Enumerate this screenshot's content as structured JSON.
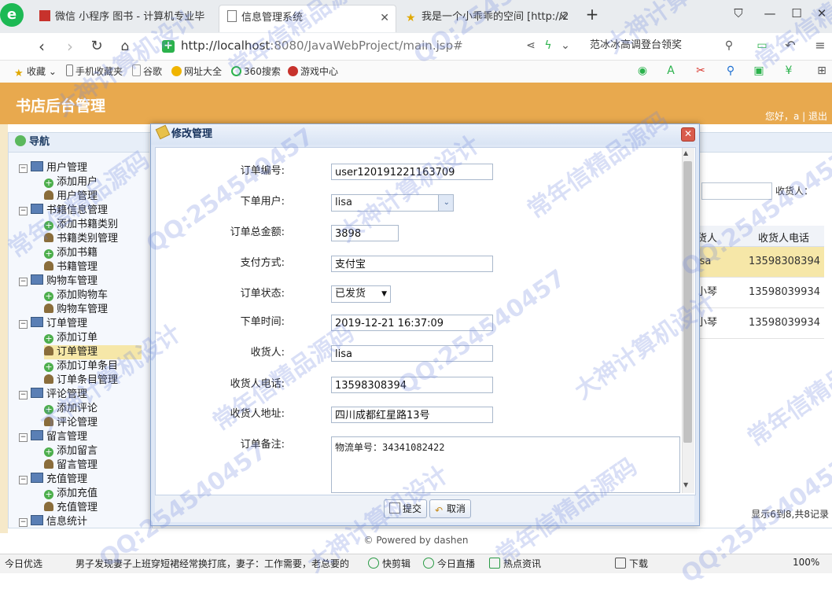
{
  "browser": {
    "tabs": [
      {
        "label": "微信 小程序 图书 - 计算机专业毕",
        "active": false,
        "icon": "red-square-icon"
      },
      {
        "label": "信息管理系统",
        "active": true,
        "icon": "page-icon"
      },
      {
        "label": "我是一个小乖乖的空间 [http://2",
        "active": false,
        "icon": "star-icon"
      }
    ],
    "url": {
      "host": "http://localhost",
      "path": ":8080/JavaWebProject/main.jsp#"
    },
    "search_hint": "范冰冰高调登台领奖",
    "favorites": [
      "收藏",
      "手机收藏夹",
      "谷歌",
      "网址大全",
      "360搜索",
      "游戏中心"
    ]
  },
  "app": {
    "title": "书店后台管理",
    "user_bar": "您好，a | 退出",
    "nav_title": "导航",
    "footer": "© Powered by dashen"
  },
  "nav": [
    {
      "label": "用户管理",
      "type": "group"
    },
    {
      "label": "添加用户",
      "type": "add"
    },
    {
      "label": "用户管理",
      "type": "manage"
    },
    {
      "label": "书籍信息管理",
      "type": "group"
    },
    {
      "label": "添加书籍类别",
      "type": "add"
    },
    {
      "label": "书籍类别管理",
      "type": "manage"
    },
    {
      "label": "添加书籍",
      "type": "add"
    },
    {
      "label": "书籍管理",
      "type": "manage"
    },
    {
      "label": "购物车管理",
      "type": "group"
    },
    {
      "label": "添加购物车",
      "type": "add"
    },
    {
      "label": "购物车管理",
      "type": "manage"
    },
    {
      "label": "订单管理",
      "type": "group"
    },
    {
      "label": "添加订单",
      "type": "add"
    },
    {
      "label": "订单管理",
      "type": "manage",
      "selected": true
    },
    {
      "label": "添加订单条目",
      "type": "add"
    },
    {
      "label": "订单条目管理",
      "type": "manage"
    },
    {
      "label": "评论管理",
      "type": "group"
    },
    {
      "label": "添加评论",
      "type": "add"
    },
    {
      "label": "评论管理",
      "type": "manage"
    },
    {
      "label": "留言管理",
      "type": "group"
    },
    {
      "label": "添加留言",
      "type": "add"
    },
    {
      "label": "留言管理",
      "type": "manage"
    },
    {
      "label": "充值管理",
      "type": "group"
    },
    {
      "label": "添加充值",
      "type": "add"
    },
    {
      "label": "充值管理",
      "type": "manage"
    },
    {
      "label": "信息统计",
      "type": "group"
    }
  ],
  "background": {
    "search_label": "收货人：",
    "columns": [
      "货人",
      "收货人电话"
    ],
    "rows": [
      [
        "isa",
        "13598308394"
      ],
      [
        "小琴",
        "13598039934"
      ],
      [
        "小琴",
        "13598039934"
      ]
    ],
    "pager": "显示6到8,共8记录"
  },
  "dialog": {
    "title": "修改管理",
    "fields": {
      "order_no": {
        "label": "订单编号:",
        "value": "user120191221163709"
      },
      "user": {
        "label": "下单用户:",
        "value": "lisa"
      },
      "total": {
        "label": "订单总金额:",
        "value": "3898"
      },
      "payment": {
        "label": "支付方式:",
        "value": "支付宝"
      },
      "status": {
        "label": "订单状态:",
        "value": "已发货"
      },
      "time": {
        "label": "下单时间:",
        "value": "2019-12-21 16:37:09"
      },
      "receiver": {
        "label": "收货人:",
        "value": "lisa"
      },
      "phone": {
        "label": "收货人电话:",
        "value": "13598308394"
      },
      "address": {
        "label": "收货人地址:",
        "value": "四川成都红星路13号"
      },
      "memo": {
        "label": "订单备注:",
        "value": "物流单号：34341082422"
      }
    },
    "submit": "提交",
    "cancel": "取消"
  },
  "statusbar": {
    "items": [
      "今日优选",
      "男子发现妻子上班穿短裙经常换打底，妻子：工作需要，老总要的",
      "快剪辑",
      "今日直播",
      "热点资讯",
      "下载",
      "100%"
    ]
  },
  "watermark": [
    "QQ:254540457",
    "大神计算机设计",
    "常年信精品源码"
  ],
  "colors": {
    "header": "#e8a94e",
    "selected_row": "#f6e7a8",
    "dialog_border": "#8aa6cf"
  }
}
